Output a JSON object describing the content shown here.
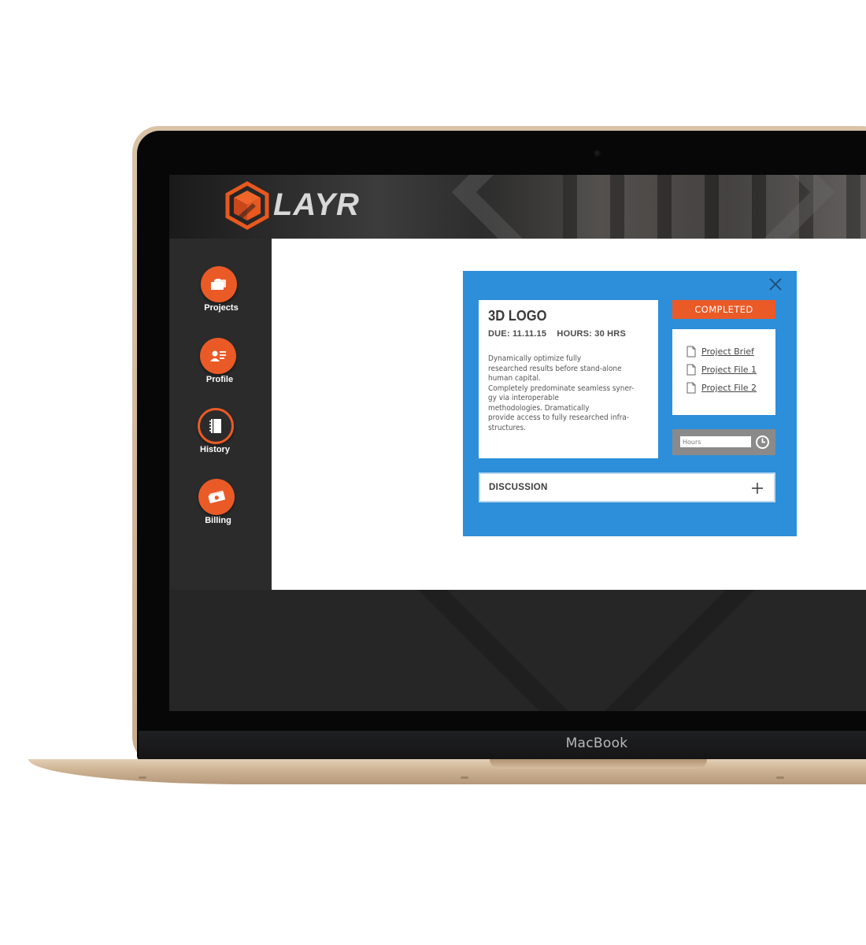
{
  "device": {
    "brand_label": "MacBook"
  },
  "app": {
    "logo_text": "LAYR"
  },
  "sidebar": {
    "items": [
      {
        "label": "Projects",
        "icon": "folders-icon"
      },
      {
        "label": "Profile",
        "icon": "profile-card-icon"
      },
      {
        "label": "History",
        "icon": "notebook-icon"
      },
      {
        "label": "Billing",
        "icon": "money-icon"
      }
    ]
  },
  "project": {
    "title": "3D LOGO",
    "due": "DUE: 11.11.15",
    "hours": "HOURS: 30 HRS",
    "description_lines": [
      "Dynamically optimize fully",
      "researched results before stand-alone",
      "human capital.",
      "Completely predominate seamless syner-",
      "gy via interoperable",
      "methodologies. Dramatically",
      "provide access to fully researched infra-",
      "structures."
    ],
    "status": "COMPLETED",
    "files": [
      "Project Brief",
      "Project File 1",
      "Project File 2"
    ],
    "hours_placeholder": "Hours",
    "discussion_label": "DISCUSSION"
  },
  "colors": {
    "accent": "#ea5a27",
    "modal_blue": "#2d8ed9",
    "sidebar_bg": "#2b2b2b"
  }
}
